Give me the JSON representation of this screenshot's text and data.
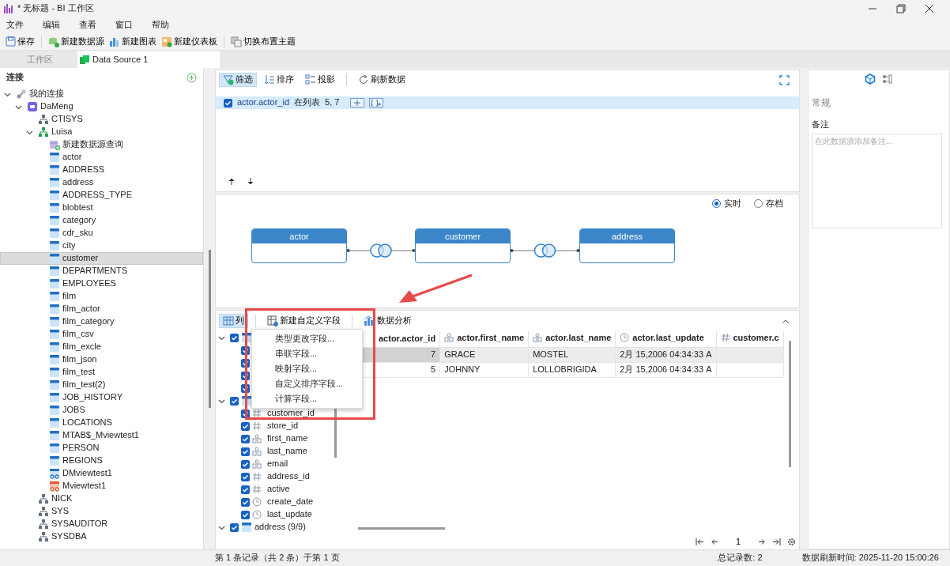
{
  "window": {
    "title": "* 无标题 - BI 工作区"
  },
  "menu": [
    "文件",
    "编辑",
    "查看",
    "窗口",
    "帮助"
  ],
  "toolbar": {
    "groups": [
      [
        {
          "label": "保存",
          "kind": "save"
        }
      ],
      [
        {
          "label": "新建数据源",
          "kind": "datasource"
        },
        {
          "label": "新建图表",
          "kind": "chart"
        },
        {
          "label": "新建仪表板",
          "kind": "dashboard"
        }
      ],
      [
        {
          "label": "切换布置主题",
          "kind": "theme"
        }
      ]
    ]
  },
  "tabs": [
    {
      "label": "工作区",
      "selected": false
    },
    {
      "label": "Data Source 1",
      "selected": true
    }
  ],
  "sidebar": {
    "title": "连接",
    "tree": [
      {
        "label": "我的连接",
        "kind": "connection",
        "selected": false,
        "expanded": true,
        "children": [
          {
            "label": "DaMeng",
            "kind": "database",
            "selected": false,
            "expanded": true,
            "children": [
              {
                "label": "CTISYS",
                "kind": "schema",
                "selected": false
              },
              {
                "label": "Luisa",
                "kind": "schema",
                "selected": false,
                "expanded": true,
                "children": [
                  {
                    "label": "新建数据源查询",
                    "kind": "new-query",
                    "selected": false
                  },
                  {
                    "label": "actor",
                    "kind": "table",
                    "selected": false
                  },
                  {
                    "label": "ADDRESS",
                    "kind": "table",
                    "selected": false
                  },
                  {
                    "label": "address",
                    "kind": "table",
                    "selected": false
                  },
                  {
                    "label": "ADDRESS_TYPE",
                    "kind": "table",
                    "selected": false
                  },
                  {
                    "label": "blobtest",
                    "kind": "table",
                    "selected": false
                  },
                  {
                    "label": "category",
                    "kind": "table",
                    "selected": false
                  },
                  {
                    "label": "cdr_sku",
                    "kind": "table",
                    "selected": false
                  },
                  {
                    "label": "city",
                    "kind": "table",
                    "selected": false
                  },
                  {
                    "label": "customer",
                    "kind": "table",
                    "selected": true
                  },
                  {
                    "label": "DEPARTMENTS",
                    "kind": "table",
                    "selected": false
                  },
                  {
                    "label": "EMPLOYEES",
                    "kind": "table",
                    "selected": false
                  },
                  {
                    "label": "film",
                    "kind": "table",
                    "selected": false
                  },
                  {
                    "label": "film_actor",
                    "kind": "table",
                    "selected": false
                  },
                  {
                    "label": "film_category",
                    "kind": "table",
                    "selected": false
                  },
                  {
                    "label": "film_csv",
                    "kind": "table",
                    "selected": false
                  },
                  {
                    "label": "film_excle",
                    "kind": "table",
                    "selected": false
                  },
                  {
                    "label": "film_json",
                    "kind": "table",
                    "selected": false
                  },
                  {
                    "label": "film_test",
                    "kind": "table",
                    "selected": false
                  },
                  {
                    "label": "film_test(2)",
                    "kind": "table",
                    "selected": false
                  },
                  {
                    "label": "JOB_HISTORY",
                    "kind": "table",
                    "selected": false
                  },
                  {
                    "label": "JOBS",
                    "kind": "table",
                    "selected": false
                  },
                  {
                    "label": "LOCATIONS",
                    "kind": "table",
                    "selected": false
                  },
                  {
                    "label": "MTAB$_Mviewtest1",
                    "kind": "table",
                    "selected": false
                  },
                  {
                    "label": "PERSON",
                    "kind": "table",
                    "selected": false
                  },
                  {
                    "label": "REGIONS",
                    "kind": "table",
                    "selected": false
                  },
                  {
                    "label": "DMviewtest1",
                    "kind": "view",
                    "selected": false
                  },
                  {
                    "label": "Mviewtest1",
                    "kind": "mview",
                    "selected": false
                  }
                ]
              },
              {
                "label": "NICK",
                "kind": "schema",
                "selected": false
              },
              {
                "label": "SYS",
                "kind": "schema",
                "selected": false
              },
              {
                "label": "SYSAUDITOR",
                "kind": "schema",
                "selected": false
              },
              {
                "label": "SYSDBA",
                "kind": "schema",
                "selected": false
              }
            ]
          }
        ]
      }
    ]
  },
  "filter_toolbar": {
    "buttons": [
      {
        "label": "筛选",
        "kind": "filter",
        "selected": true
      },
      {
        "label": "排序",
        "kind": "sort",
        "selected": false
      },
      {
        "label": "投影",
        "kind": "projection",
        "selected": false
      }
    ],
    "actions": [
      {
        "label": "刷新数据",
        "kind": "refresh"
      }
    ]
  },
  "filters": [
    {
      "checked": true,
      "field": "actor.actor_id",
      "operator": "在列表",
      "value": "5, 7"
    }
  ],
  "diagram": {
    "modes": [
      {
        "label": "实时",
        "selected": true
      },
      {
        "label": "存档",
        "selected": false
      }
    ],
    "tables": [
      "actor",
      "customer",
      "address"
    ]
  },
  "bottom_toolbar": {
    "tabs": [
      {
        "label": "列",
        "kind": "columns",
        "selected": true
      }
    ],
    "buttons": [
      {
        "label": "新建自定义字段",
        "kind": "custom-field"
      },
      {
        "label": "数据分析",
        "kind": "analysis"
      }
    ]
  },
  "field_menu": {
    "items": [
      "类型更改字段...",
      "串联字段...",
      "映射字段...",
      "自定义排序字段...",
      "计算字段..."
    ]
  },
  "column_tree": [
    {
      "checked": true,
      "expanded": true,
      "children": [
        {
          "checked": true
        },
        {
          "checked": true
        },
        {
          "checked": true
        },
        {
          "checked": true
        }
      ]
    },
    {
      "checked": true,
      "expanded": true,
      "children": [
        {
          "label": "customer_id",
          "kind": "number",
          "checked": true
        },
        {
          "label": "store_id",
          "kind": "number",
          "checked": true
        },
        {
          "label": "first_name",
          "kind": "string",
          "checked": true
        },
        {
          "label": "last_name",
          "kind": "string",
          "checked": true
        },
        {
          "label": "email",
          "kind": "string",
          "checked": true
        },
        {
          "label": "address_id",
          "kind": "number",
          "checked": true
        },
        {
          "label": "active",
          "kind": "number",
          "checked": true
        },
        {
          "label": "create_date",
          "kind": "datetime",
          "checked": true
        },
        {
          "label": "last_update",
          "kind": "datetime",
          "checked": true
        }
      ]
    },
    {
      "label": "address (9/9)",
      "checked": true,
      "expanded": true
    }
  ],
  "grid": {
    "columns": [
      {
        "label": "actor.actor_id"
      },
      {
        "label": "actor.first_name",
        "kind": "string"
      },
      {
        "label": "actor.last_name",
        "kind": "string"
      },
      {
        "label": "actor.last_update",
        "kind": "datetime"
      },
      {
        "label": "customer.c",
        "kind": "number"
      }
    ],
    "rows": [
      {
        "selected": true,
        "cells": [
          "7",
          "GRACE",
          "MOSTEL",
          "2月 15,2006 04:34:33 A"
        ]
      },
      {
        "selected": false,
        "cells": [
          "5",
          "JOHNNY",
          "LOLLOBRIGIDA",
          "2月 15,2006 04:34:33 A"
        ]
      }
    ]
  },
  "pager": {
    "page": "1"
  },
  "properties": {
    "tabs": [
      {
        "kind": "general",
        "selected": true
      },
      {
        "kind": "links",
        "selected": false
      }
    ],
    "section": "常规",
    "notes_label": "备注",
    "notes_placeholder": "在此数据源添加备注..."
  },
  "status_bar": {
    "record": "第 1 条记录（共 2 条）于第 1 页",
    "total": "总记录数: 2",
    "refreshed": "数据刷新时间: 2025-11-20 15:00:26"
  }
}
